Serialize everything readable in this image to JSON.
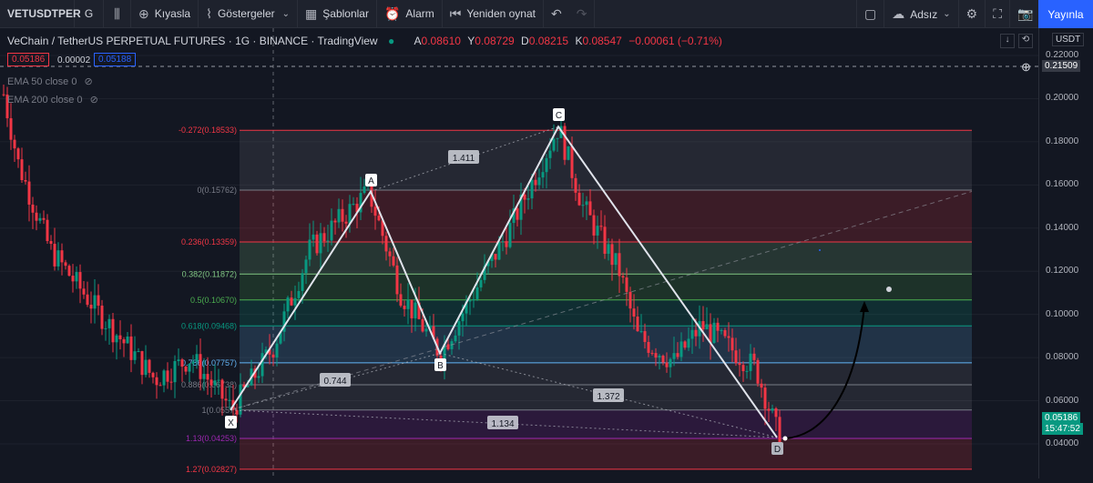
{
  "toolbar": {
    "symbol": "VETUSDTPER",
    "interval": "G",
    "compare": "Kıyasla",
    "indicators": "Göstergeler",
    "templates": "Şablonlar",
    "alarm": "Alarm",
    "replay": "Yeniden oynat",
    "layout_name": "Adsız",
    "publish": "Yayınla"
  },
  "legend": {
    "title": "VeChain / TetherUS PERPETUAL FUTURES · 1G · BINANCE · TradingView",
    "o_label": "A",
    "o_val": "0.08610",
    "h_label": "Y",
    "h_val": "0.08729",
    "l_label": "D",
    "l_val": "0.08215",
    "c_label": "K",
    "c_val": "0.08547",
    "change": "−0.00061 (−0.71%)",
    "sell": "0.05186",
    "spread": "0.00002",
    "buy": "0.05188",
    "ema50": "EMA 50 close 0",
    "ema200": "EMA 200 close 0"
  },
  "axis": {
    "currency": "USDT",
    "ticks": [
      "0.22000",
      "0.20000",
      "0.18000",
      "0.16000",
      "0.14000",
      "0.12000",
      "0.10000",
      "0.08000",
      "0.06000",
      "0.04000"
    ],
    "crosshair_price": "0.21509",
    "last_price": "0.05186",
    "countdown": "15:47:52"
  },
  "fib": [
    {
      "label": "-0.272(0.18533)",
      "price": 0.18533,
      "color": "#f23645"
    },
    {
      "label": "0(0.15762)",
      "price": 0.15762,
      "color": "#787b86"
    },
    {
      "label": "0.236(0.13359)",
      "price": 0.13359,
      "color": "#f23645"
    },
    {
      "label": "0.382(0.11872)",
      "price": 0.11872,
      "color": "#81c784"
    },
    {
      "label": "0.5(0.10670)",
      "price": 0.1067,
      "color": "#4caf50"
    },
    {
      "label": "0.618(0.09468)",
      "price": 0.09468,
      "color": "#089981"
    },
    {
      "label": "0.786(0.07757)",
      "price": 0.07757,
      "color": "#64b5f6"
    },
    {
      "label": "0.886(0.06738)",
      "price": 0.06738,
      "color": "#787b86"
    },
    {
      "label": "1(0.0557)",
      "price": 0.0557,
      "color": "#787b86"
    },
    {
      "label": "1.13(0.04253)",
      "price": 0.04253,
      "color": "#9c27b0"
    },
    {
      "label": "1.27(0.02827)",
      "price": 0.02827,
      "color": "#f23645"
    }
  ],
  "pattern": {
    "points": [
      {
        "name": "X",
        "price": 0.0557
      },
      {
        "name": "A",
        "price": 0.157
      },
      {
        "name": "B",
        "price": 0.082
      },
      {
        "name": "C",
        "price": 0.187
      },
      {
        "name": "D",
        "price": 0.043
      }
    ],
    "ratios": {
      "xb": "0.744",
      "ac": "1.411",
      "bd": "1.372",
      "xd": "1.134"
    }
  }
}
